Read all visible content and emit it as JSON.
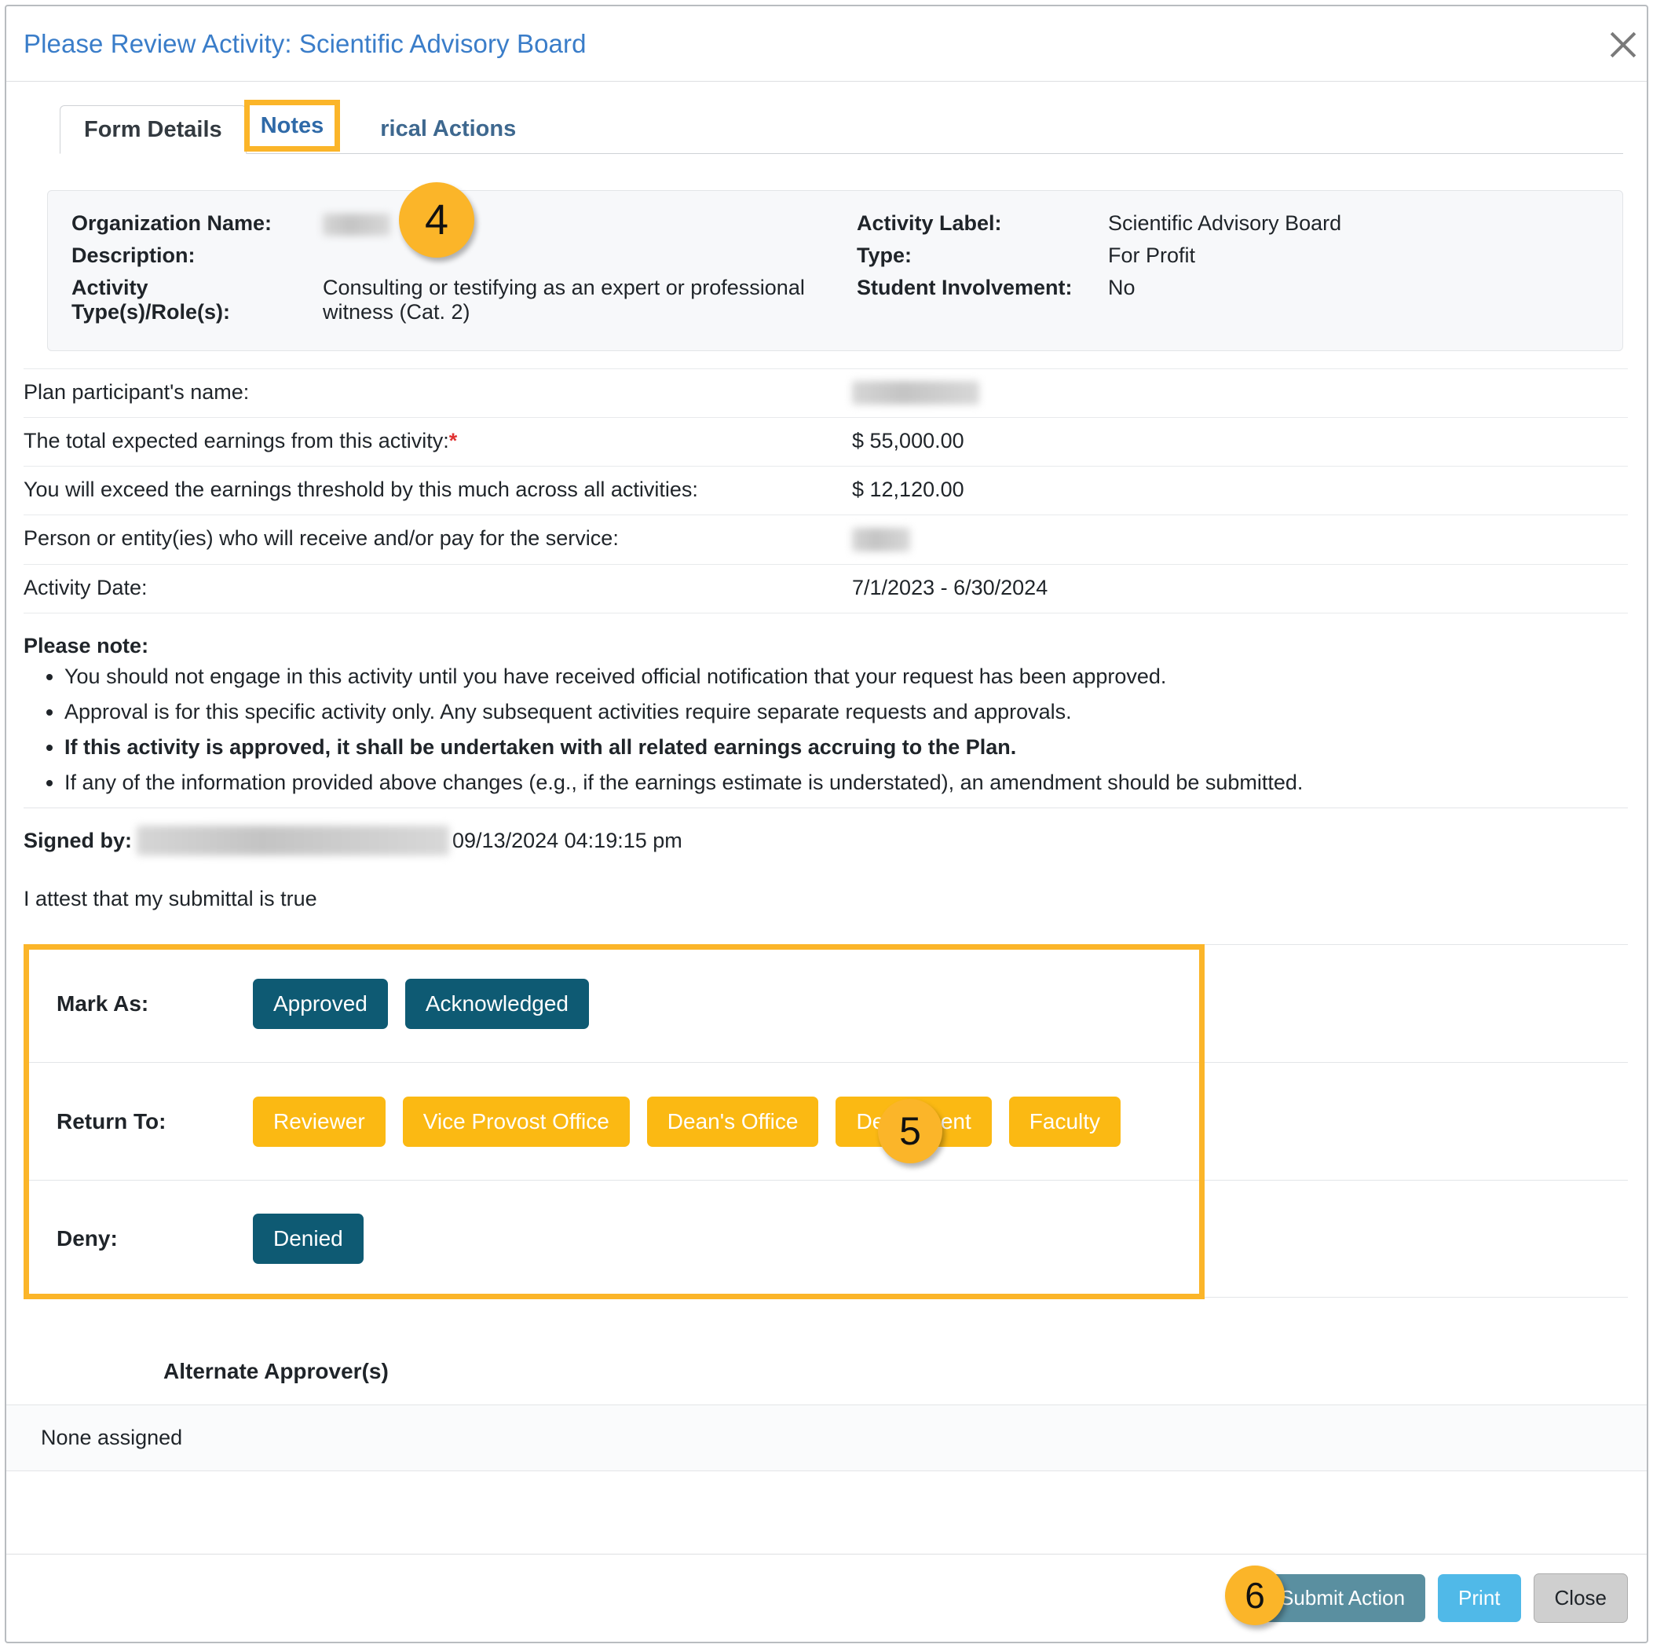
{
  "dialog": {
    "title": "Please Review Activity: Scientific Advisory Board",
    "close_icon": "close-x-icon"
  },
  "tabs": [
    {
      "label": "Form Details",
      "state": "active"
    },
    {
      "label": "Notes",
      "state": "highlighted"
    },
    {
      "label": "rical Actions",
      "state": "partially-obscured"
    }
  ],
  "callouts": [
    {
      "number": "4",
      "target": "notes-tab"
    },
    {
      "number": "5",
      "target": "action-buttons-box"
    },
    {
      "number": "6",
      "target": "submit-action-button"
    }
  ],
  "summary": {
    "left": {
      "labels": [
        "Organization Name:",
        "Description:",
        "Activity Type(s)/Role(s):"
      ],
      "values": [
        "",
        "",
        "Consulting or testifying as an expert or professional witness (Cat. 2)"
      ]
    },
    "right": {
      "labels": [
        "Activity Label:",
        "Type:",
        "Student Involvement:"
      ],
      "values": [
        "Scientific Advisory Board",
        "For Profit",
        "No"
      ]
    }
  },
  "fields": [
    {
      "label": "Plan participant's name:",
      "value": "",
      "required": false,
      "redacted": true
    },
    {
      "label": "The total expected earnings from this activity:",
      "value": "$ 55,000.00",
      "required": true,
      "redacted": false
    },
    {
      "label": "You will exceed the earnings threshold by this much across all activities:",
      "value": "$ 12,120.00",
      "required": false,
      "redacted": false
    },
    {
      "label": "Person or entity(ies) who will receive and/or pay for the service:",
      "value": "",
      "required": false,
      "redacted": true
    },
    {
      "label": "Activity Date:",
      "value": "7/1/2023 - 6/30/2024",
      "required": false,
      "redacted": false
    }
  ],
  "note": {
    "title": "Please note:",
    "items": [
      {
        "text": "You should not engage in this activity until you have received official notification that your request has been approved.",
        "bold": false
      },
      {
        "text": "Approval is for this specific activity only. Any subsequent activities require separate requests and approvals.",
        "bold": false
      },
      {
        "text": "If this activity is approved, it shall be undertaken with all related earnings accruing to the Plan.",
        "bold": true
      },
      {
        "text": "If any of the information provided above changes (e.g., if the earnings estimate is understated), an amendment should be submitted.",
        "bold": false
      }
    ]
  },
  "signature": {
    "label": "Signed by:",
    "name": "",
    "timestamp": "09/13/2024 04:19:15 pm",
    "attestation": "I attest that my submittal is true"
  },
  "actions": {
    "rows": [
      {
        "label": "Mark As:",
        "style": "teal",
        "buttons": [
          "Approved",
          "Acknowledged"
        ]
      },
      {
        "label": "Return To:",
        "style": "amber",
        "buttons": [
          "Reviewer",
          "Vice Provost Office",
          "Dean's Office",
          "Department",
          "Faculty"
        ]
      },
      {
        "label": "Deny:",
        "style": "teal",
        "buttons": [
          "Denied"
        ]
      }
    ]
  },
  "alternate_approvers": {
    "heading": "Alternate Approver(s)",
    "value": "None assigned"
  },
  "footer": {
    "submit_label": "Submit Action",
    "print_label": "Print",
    "close_label": "Close"
  },
  "colors": {
    "title_blue": "#3a7dc9",
    "highlight_amber": "#fbb529",
    "button_teal": "#0e5a73",
    "button_amber": "#fbb913",
    "submit_slate": "#5a8fa0",
    "print_blue": "#50b9e8"
  }
}
